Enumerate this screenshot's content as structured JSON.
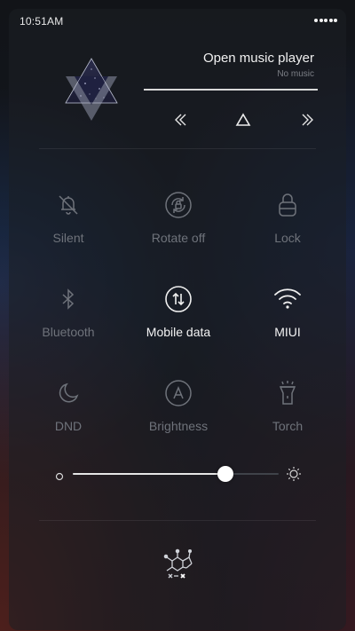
{
  "status_bar": {
    "time": "10:51AM"
  },
  "music": {
    "title": "Open music player",
    "subtitle": "No music",
    "controls": {
      "prev_icon": "double-chevron-left-icon",
      "play_icon": "triangle-play-icon",
      "next_icon": "double-chevron-right-icon"
    }
  },
  "toggles": [
    {
      "label": "Silent",
      "icon": "bell-off-icon",
      "on": false
    },
    {
      "label": "Rotate off",
      "icon": "rotate-lock-icon",
      "on": false
    },
    {
      "label": "Lock",
      "icon": "lock-icon",
      "on": false
    },
    {
      "label": "Bluetooth",
      "icon": "bluetooth-icon",
      "on": false
    },
    {
      "label": "Mobile data",
      "icon": "mobile-data-icon",
      "on": true
    },
    {
      "label": "MIUI",
      "icon": "wifi-icon",
      "on": true
    },
    {
      "label": "DND",
      "icon": "moon-icon",
      "on": false
    },
    {
      "label": "Brightness",
      "icon": "auto-brightness-icon",
      "on": false
    },
    {
      "label": "Torch",
      "icon": "flashlight-icon",
      "on": false
    }
  ],
  "brightness": {
    "level_percent": 74,
    "min_icon": "brightness-low-icon",
    "max_icon": "brightness-high-icon"
  },
  "colors": {
    "active_label": "#f3f3f3",
    "inactive_label": "#6f737b"
  }
}
